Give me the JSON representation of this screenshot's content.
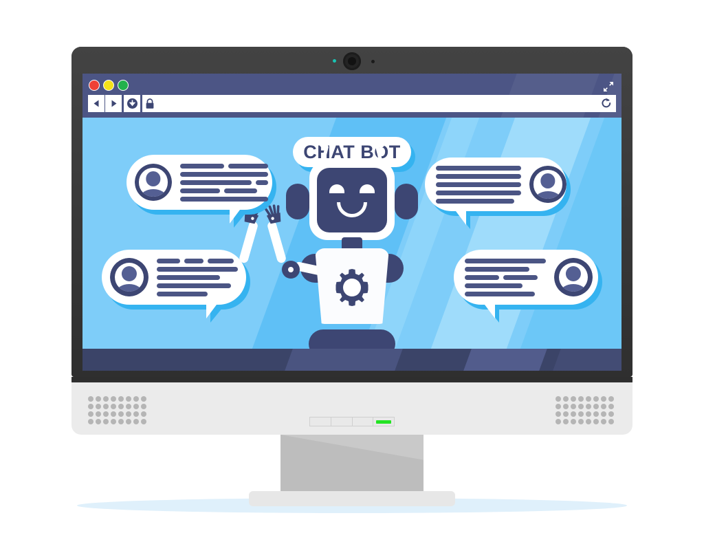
{
  "scene": {
    "device": "desktop-monitor",
    "colors": {
      "bezel": "#3a3a3a",
      "chrome": "#4c5585",
      "screen_bg": "#7ecdf9",
      "accent_navy": "#3d4673",
      "bubble_shadow": "#35b3f0",
      "led_green": "#24e324",
      "led_teal": "#19c3b2"
    }
  },
  "browser": {
    "traffic_lights": [
      {
        "name": "close",
        "color": "#ef4136"
      },
      {
        "name": "minimize",
        "color": "#f3e21a"
      },
      {
        "name": "maximize",
        "color": "#22b14c"
      }
    ],
    "expand_icon": "expand-arrows-icon",
    "nav": {
      "back_icon": "back-triangle-icon",
      "forward_icon": "forward-triangle-icon",
      "download_icon": "download-circle-icon",
      "lock_icon": "padlock-icon",
      "reload_icon": "reload-arrow-icon"
    },
    "address_bar": {
      "value": "",
      "placeholder": ""
    }
  },
  "page": {
    "title": "CHAT BOT",
    "robot": {
      "name": "chatbot-robot",
      "expression": "smiling",
      "torso_icon": "gear-icon",
      "antennae": 2,
      "hands": [
        "left-hand-waving",
        "right-hand-waving"
      ]
    },
    "bubbles": [
      {
        "name": "chat-bubble-top-left",
        "avatar_side": "left",
        "tail": "bottom-right",
        "lines": [
          [
            64,
            78
          ],
          [
            128
          ],
          [
            104,
            20
          ],
          [
            58,
            48
          ],
          [
            128
          ]
        ]
      },
      {
        "name": "chat-bubble-top-right",
        "avatar_side": "right",
        "tail": "bottom-left",
        "lines": [
          [
            128
          ],
          [
            128
          ],
          [
            128
          ],
          [
            128
          ],
          [
            118
          ]
        ]
      },
      {
        "name": "chat-bubble-bottom-left",
        "avatar_side": "left",
        "tail": "bottom-right",
        "lines": [
          [
            40,
            34,
            44
          ],
          [
            122
          ],
          [
            96
          ],
          [
            110
          ],
          [
            78
          ]
        ]
      },
      {
        "name": "chat-bubble-bottom-right",
        "avatar_side": "right",
        "tail": "bottom-left",
        "lines": [
          [
            122
          ],
          [
            98
          ],
          [
            54,
            54
          ],
          [
            88
          ],
          [
            106
          ]
        ]
      }
    ]
  },
  "hardware": {
    "webcam": {
      "name": "webcam",
      "led": "on"
    },
    "speakers": {
      "columns": 8,
      "rows": 4
    },
    "control_strip": {
      "segments": 4,
      "led_on_segment": 4
    }
  }
}
